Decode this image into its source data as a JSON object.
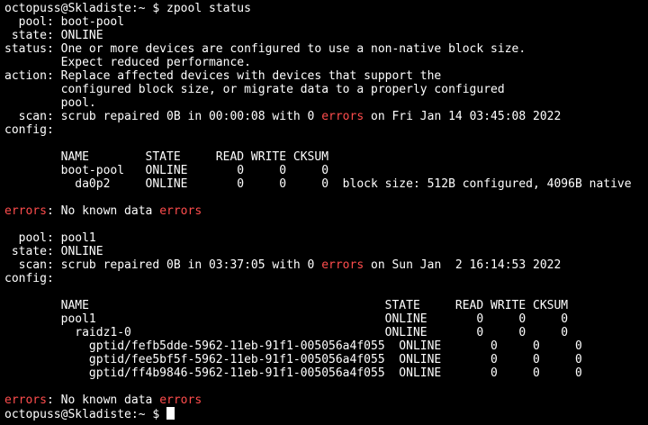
{
  "colors": {
    "background": "#000000",
    "foreground": "#ffffff",
    "error_red": "#ff4d4d"
  },
  "terminal": {
    "prompt": "octopuss@Skladiste:~ $ ",
    "command": "zpool status",
    "final_prompt": "octopuss@Skladiste:~ $ "
  },
  "pool1": {
    "pool_line": "  pool: boot-pool",
    "state_line": " state: ONLINE",
    "status_line1": "status: One or more devices are configured to use a non-native block size.",
    "status_line2": "        Expect reduced performance.",
    "action_line1": "action: Replace affected devices with devices that support the",
    "action_line2": "        configured block size, or migrate data to a properly configured",
    "action_line3": "        pool.",
    "scan_a": "  scan: scrub repaired 0B in 00:00:08 with 0 ",
    "scan_err": "errors",
    "scan_b": " on Fri Jan 14 03:45:08 2022",
    "config_line": "config:",
    "header": "        NAME        STATE     READ WRITE CKSUM",
    "row1": "        boot-pool   ONLINE       0     0     0",
    "row2": "          da0p2     ONLINE       0     0     0  block size: 512B configured, 4096B native",
    "errors_label": "errors",
    "errors_a": ": No known data ",
    "errors_b": "errors"
  },
  "pool2": {
    "pool_line": "  pool: pool1",
    "state_line": " state: ONLINE",
    "scan_a": "  scan: scrub repaired 0B in 03:37:05 with 0 ",
    "scan_err": "errors",
    "scan_b": " on Sun Jan  2 16:14:53 2022",
    "config_line": "config:",
    "header": "        NAME                                          STATE     READ WRITE CKSUM",
    "row1": "        pool1                                         ONLINE       0     0     0",
    "row2": "          raidz1-0                                    ONLINE       0     0     0",
    "row3": "            gptid/fefb5dde-5962-11eb-91f1-005056a4f055  ONLINE       0     0     0",
    "row4": "            gptid/fee5bf5f-5962-11eb-91f1-005056a4f055  ONLINE       0     0     0",
    "row5": "            gptid/ff4b9846-5962-11eb-91f1-005056a4f055  ONLINE       0     0     0",
    "errors_label": "errors",
    "errors_a": ": No known data ",
    "errors_b": "errors"
  }
}
